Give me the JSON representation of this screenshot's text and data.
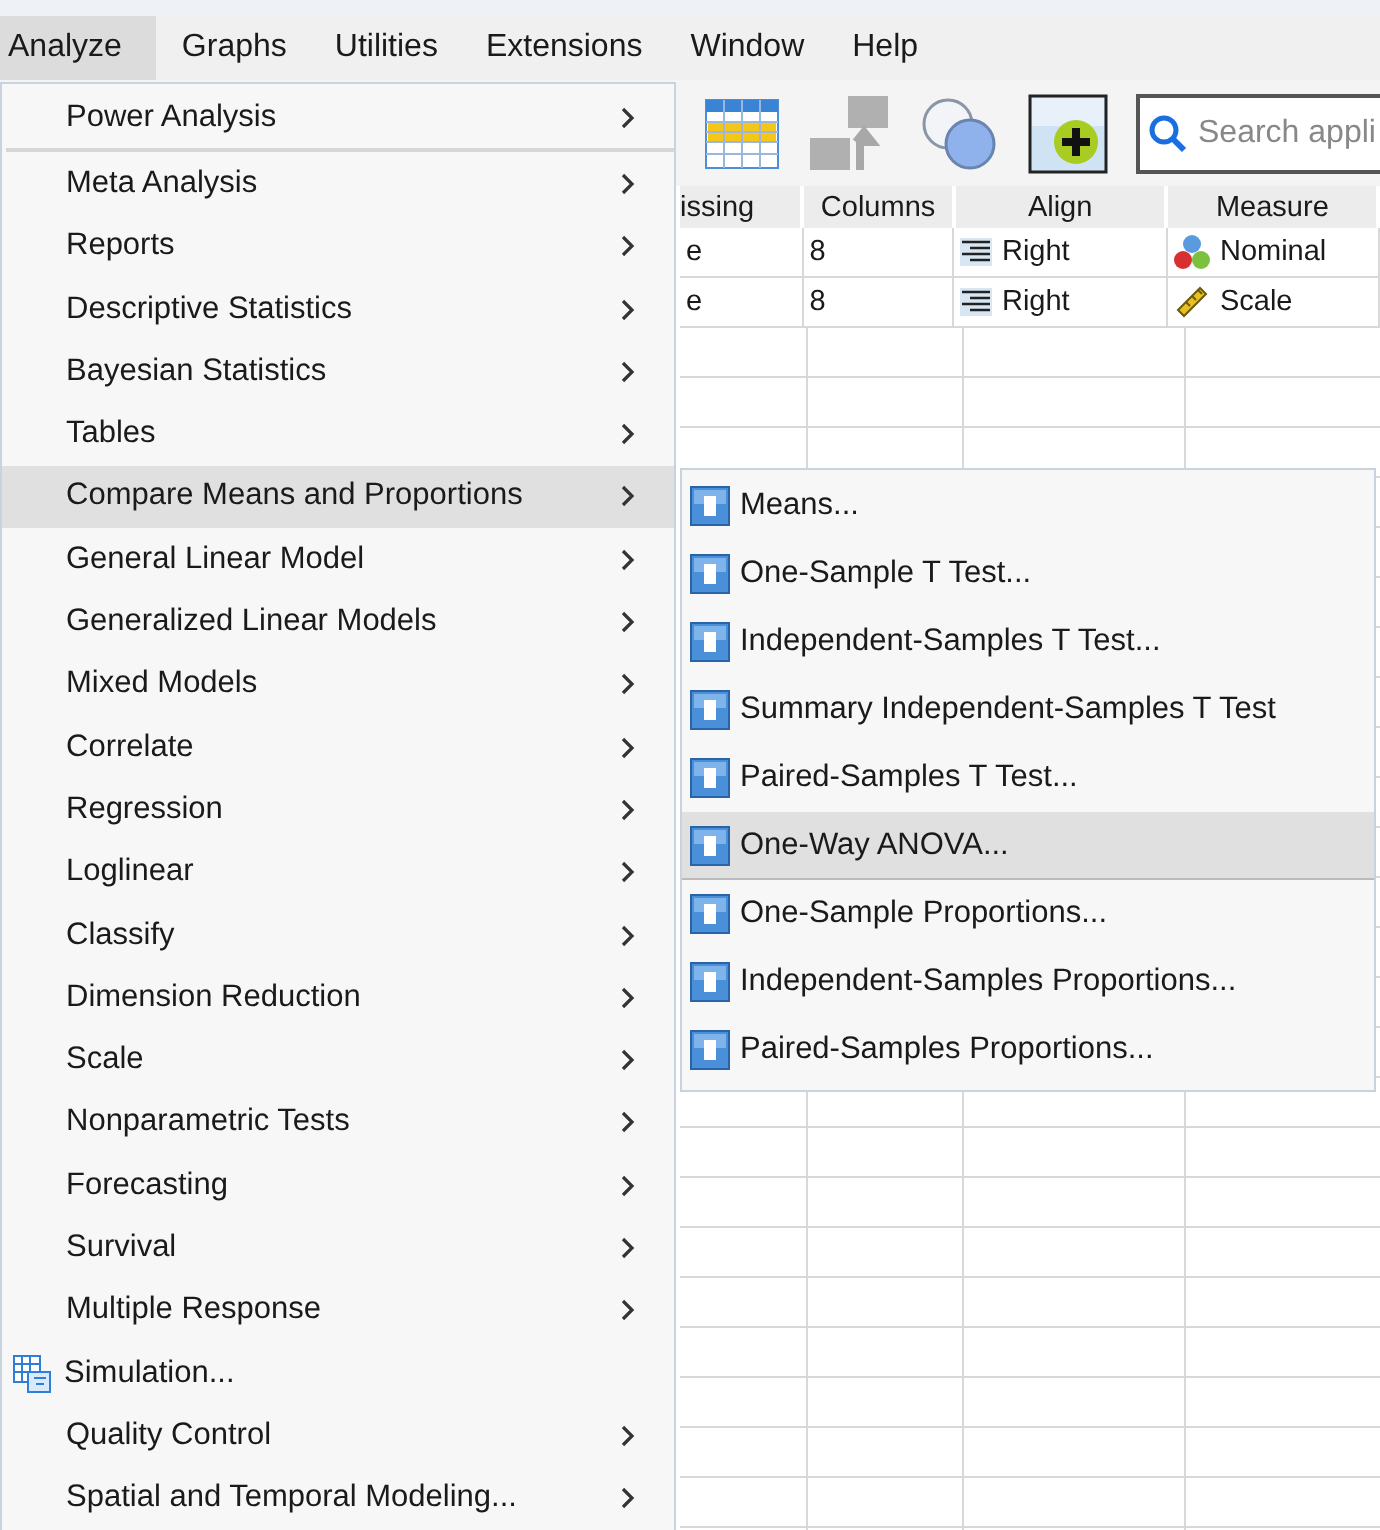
{
  "menubar": [
    {
      "label": "Analyze",
      "selected": true
    },
    {
      "label": "Graphs",
      "selected": false
    },
    {
      "label": "Utilities",
      "selected": false
    },
    {
      "label": "Extensions",
      "selected": false
    },
    {
      "label": "Window",
      "selected": false
    },
    {
      "label": "Help",
      "selected": false
    }
  ],
  "toolbar": {
    "search": {
      "placeholder": "Search appli"
    }
  },
  "grid": {
    "columns": [
      "issing",
      "Columns",
      "Align",
      "Measure"
    ],
    "rows": [
      {
        "cells": [
          "e",
          "8",
          "Right",
          "Nominal"
        ],
        "kind": "nominal"
      },
      {
        "cells": [
          "e",
          "8",
          "Right",
          "Scale"
        ],
        "kind": "scale"
      }
    ]
  },
  "analyze_menu": [
    {
      "kind": "submenu",
      "label": "Power Analysis",
      "selected": false
    },
    {
      "kind": "separator"
    },
    {
      "kind": "submenu",
      "label": "Meta Analysis",
      "selected": false
    },
    {
      "kind": "submenu",
      "label": "Reports",
      "selected": false
    },
    {
      "kind": "submenu",
      "label": "Descriptive Statistics",
      "selected": false
    },
    {
      "kind": "submenu",
      "label": "Bayesian Statistics",
      "selected": false
    },
    {
      "kind": "submenu",
      "label": "Tables",
      "selected": false
    },
    {
      "kind": "submenu",
      "label": "Compare Means and Proportions",
      "selected": true
    },
    {
      "kind": "submenu",
      "label": "General Linear Model",
      "selected": false
    },
    {
      "kind": "submenu",
      "label": "Generalized Linear Models",
      "selected": false
    },
    {
      "kind": "submenu",
      "label": "Mixed Models",
      "selected": false
    },
    {
      "kind": "submenu",
      "label": "Correlate",
      "selected": false
    },
    {
      "kind": "submenu",
      "label": "Regression",
      "selected": false
    },
    {
      "kind": "submenu",
      "label": "Loglinear",
      "selected": false
    },
    {
      "kind": "submenu",
      "label": "Classify",
      "selected": false
    },
    {
      "kind": "submenu",
      "label": "Dimension Reduction",
      "selected": false
    },
    {
      "kind": "submenu",
      "label": "Scale",
      "selected": false
    },
    {
      "kind": "submenu",
      "label": "Nonparametric Tests",
      "selected": false
    },
    {
      "kind": "submenu",
      "label": "Forecasting",
      "selected": false
    },
    {
      "kind": "submenu",
      "label": "Survival",
      "selected": false
    },
    {
      "kind": "submenu",
      "label": "Multiple Response",
      "selected": false
    },
    {
      "kind": "action",
      "label": "Simulation...",
      "selected": false
    },
    {
      "kind": "submenu",
      "label": "Quality Control",
      "selected": false
    },
    {
      "kind": "submenu",
      "label": "Spatial and Temporal Modeling...",
      "selected": false
    }
  ],
  "compare_submenu": [
    {
      "label": "Means...",
      "selected": false
    },
    {
      "label": "One-Sample T Test...",
      "selected": false
    },
    {
      "label": "Independent-Samples T Test...",
      "selected": false
    },
    {
      "label": "Summary Independent-Samples T Test",
      "selected": false
    },
    {
      "label": "Paired-Samples T Test...",
      "selected": false
    },
    {
      "label": "One-Way ANOVA...",
      "selected": true
    },
    {
      "label": "One-Sample Proportions...",
      "selected": false
    },
    {
      "label": "Independent-Samples Proportions...",
      "selected": false
    },
    {
      "label": "Paired-Samples Proportions...",
      "selected": false
    }
  ]
}
